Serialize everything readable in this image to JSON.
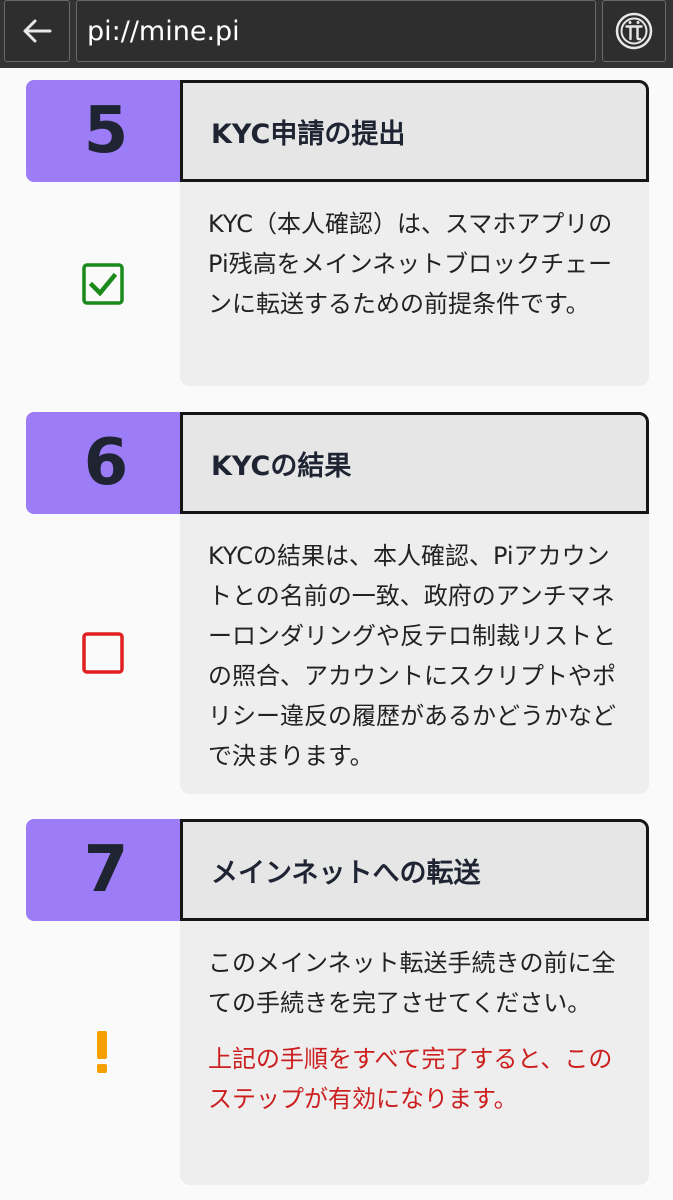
{
  "browser": {
    "url": "pi://mine.pi",
    "back_icon": "arrow-left-icon",
    "pi_icon": "pi-logo-icon"
  },
  "steps": [
    {
      "number": "5",
      "title": "KYC申請の提出",
      "status": "checked",
      "status_color": "#1a8a1a",
      "description": [
        "KYC（本人確認）は、スマホアプリのPi残高をメインネットブロックチェーンに転送するための前提条件です。"
      ]
    },
    {
      "number": "6",
      "title": "KYCの結果",
      "status": "unchecked",
      "status_color": "#e02020",
      "description": [
        "KYCの結果は、本人確認、Piアカウントとの名前の一致、政府のアンチマネーロンダリングや反テロ制裁リストとの照合、アカウントにスクリプトやポリシー違反の履歴があるかどうかなどで決まります。"
      ]
    },
    {
      "number": "7",
      "title": "メインネットへの転送",
      "status": "warning",
      "status_color": "#f5a000",
      "description": [
        "このメインネット転送手続きの前に全ての手続きを完了させてください。"
      ],
      "note": "上記の手順をすべて完了すると、このステップが有効になります。"
    }
  ],
  "colors": {
    "accent": "#9d7df7",
    "topbar": "#333333",
    "card": "#eeeeee",
    "warning_text": "#cc1f1f"
  }
}
